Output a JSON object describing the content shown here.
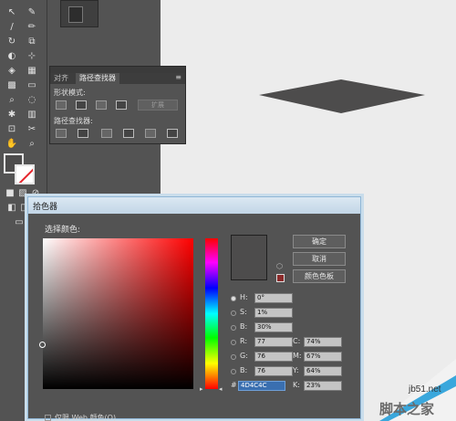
{
  "pathfinder_panel": {
    "tabs": [
      "对齐",
      "路径查找器"
    ],
    "shape_modes_label": "形状模式:",
    "pathfinders_label": "路径查找器:",
    "expand_label": "扩展"
  },
  "canvas": {
    "shape_color": "#4d4c4c"
  },
  "toolbar": {
    "fill_color": "#4d4c4c",
    "stroke_color": "#ffffff"
  },
  "color_picker": {
    "title": "拾色器",
    "select_color_label": "选择颜色:",
    "ok_label": "确定",
    "cancel_label": "取消",
    "swatches_label": "颜色色板",
    "fields": {
      "H": {
        "label": "H:",
        "value": "0°"
      },
      "S": {
        "label": "S:",
        "value": "1%"
      },
      "Br": {
        "label": "B:",
        "value": "30%"
      },
      "R": {
        "label": "R:",
        "value": "77"
      },
      "G": {
        "label": "G:",
        "value": "76"
      },
      "B": {
        "label": "B:",
        "value": "76"
      },
      "C": {
        "label": "C:",
        "value": "74%"
      },
      "M": {
        "label": "M:",
        "value": "67%"
      },
      "Y": {
        "label": "Y:",
        "value": "64%"
      },
      "K": {
        "label": "K:",
        "value": "23%"
      },
      "hex": {
        "label": "#",
        "value": "4D4C4C"
      }
    },
    "web_only_label": "仅限 Web 颜色(O)",
    "current_color": "#4d4c4c"
  },
  "watermark": {
    "url": "jb51.net",
    "text": "脚本之家"
  }
}
